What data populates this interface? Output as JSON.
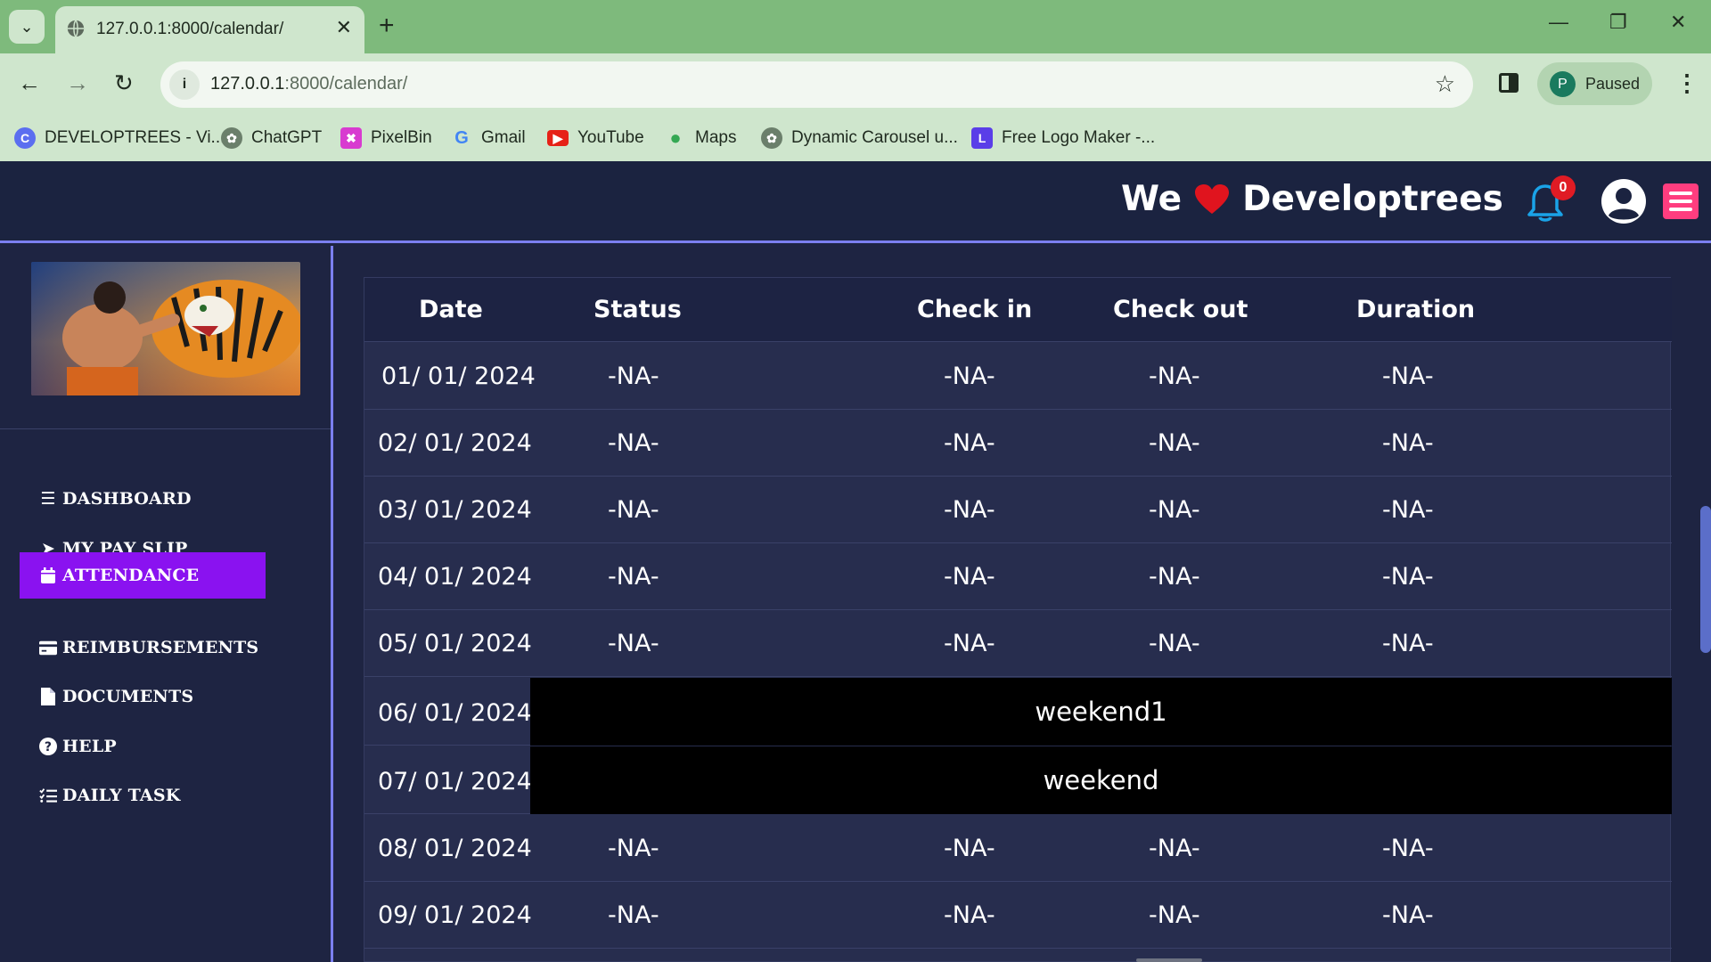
{
  "browser": {
    "tab_title": "127.0.0.1:8000/calendar/",
    "url_host": "127.0.0.1",
    "url_path": ":8000/calendar/",
    "profile_initial": "P",
    "profile_status": "Paused",
    "bookmarks": [
      {
        "label": "DEVELOPTREES - Vi...",
        "icon": "developtrees-icon",
        "color": "#5b6ef0"
      },
      {
        "label": "ChatGPT",
        "icon": "chatgpt-icon",
        "color": "#6b7f6b"
      },
      {
        "label": "PixelBin",
        "icon": "pixelbin-icon",
        "color": "#d83bd0"
      },
      {
        "label": "Gmail",
        "icon": "google-icon",
        "color": "#4285f4"
      },
      {
        "label": "YouTube",
        "icon": "youtube-icon",
        "color": "#e62117"
      },
      {
        "label": "Maps",
        "icon": "maps-icon",
        "color": "#34a853"
      },
      {
        "label": "Dynamic Carousel u...",
        "icon": "chatgpt-icon",
        "color": "#6b7f6b"
      },
      {
        "label": "Free Logo Maker -...",
        "icon": "logomaker-icon",
        "color": "#5a3ee8"
      }
    ]
  },
  "header": {
    "brand_prefix": "We",
    "brand_name": "Developtrees",
    "notification_count": "0"
  },
  "sidebar": {
    "items": [
      {
        "label": "DASHBOARD",
        "icon": "bars-icon",
        "active": false
      },
      {
        "label": "MY PAY SLIP",
        "icon": "paper-plane-icon",
        "active": false
      },
      {
        "label": "ATTENDANCE",
        "icon": "calendar-icon",
        "active": true
      },
      {
        "label": "REIMBURSEMENTS",
        "icon": "credit-card-icon",
        "active": false
      },
      {
        "label": "DOCUMENTS",
        "icon": "file-icon",
        "active": false
      },
      {
        "label": "HELP",
        "icon": "question-circle-icon",
        "active": false
      },
      {
        "label": "DAILY TASK",
        "icon": "list-check-icon",
        "active": false
      }
    ]
  },
  "table": {
    "headers": [
      "Date",
      "Status",
      "Check in",
      "Check out",
      "Duration"
    ],
    "rows": [
      {
        "date": "01/ 01/ 2024",
        "status": "-NA-",
        "check_in": "-NA-",
        "check_out": "-NA-",
        "duration": "-NA-"
      },
      {
        "date": "02/ 01/ 2024",
        "status": "-NA-",
        "check_in": "-NA-",
        "check_out": "-NA-",
        "duration": "-NA-"
      },
      {
        "date": "03/ 01/ 2024",
        "status": "-NA-",
        "check_in": "-NA-",
        "check_out": "-NA-",
        "duration": "-NA-"
      },
      {
        "date": "04/ 01/ 2024",
        "status": "-NA-",
        "check_in": "-NA-",
        "check_out": "-NA-",
        "duration": "-NA-"
      },
      {
        "date": "05/ 01/ 2024",
        "status": "-NA-",
        "check_in": "-NA-",
        "check_out": "-NA-",
        "duration": "-NA-"
      },
      {
        "date": "06/ 01/ 2024",
        "weekend": "weekend1"
      },
      {
        "date": "07/ 01/ 2024",
        "weekend": "weekend"
      },
      {
        "date": "08/ 01/ 2024",
        "status": "-NA-",
        "check_in": "-NA-",
        "check_out": "-NA-",
        "duration": "-NA-"
      },
      {
        "date": "09/ 01/ 2024",
        "status": "-NA-",
        "check_in": "-NA-",
        "check_out": "-NA-",
        "duration": "-NA-"
      }
    ]
  },
  "colors": {
    "chrome": "#7eba7c",
    "header_bg": "#1b2340",
    "accent_border": "#7b7ff0",
    "active_nav": "#8a12f0",
    "menu_button": "#ff3d7f",
    "bell": "#1aa3e8",
    "badge": "#e01b24"
  }
}
